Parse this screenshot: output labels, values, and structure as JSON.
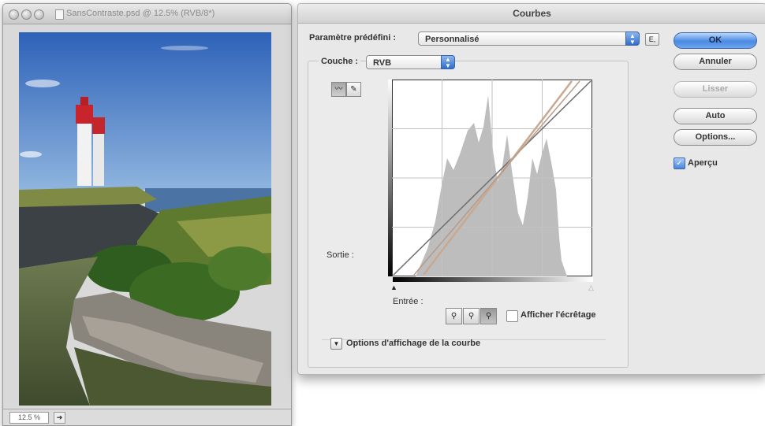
{
  "document": {
    "title": "SansContraste.psd @ 12.5% (RVB/8*)",
    "zoom": "12.5 %",
    "status_icon": "➔"
  },
  "curves_dialog": {
    "title": "Courbes",
    "preset_label": "Paramètre prédéfini :",
    "preset_value": "Personnalisé",
    "preset_menu_icon": "E,",
    "channel_label": "Couche :",
    "channel_value": "RVB",
    "output_label": "Sortie :",
    "input_label": "Entrée :",
    "show_clipping_label": "Afficher l'écrêtage",
    "show_clipping_checked": false,
    "curve_display_options_label": "Options d'affichage de la courbe",
    "buttons": {
      "ok": "OK",
      "cancel": "Annuler",
      "smooth": "Lisser",
      "auto": "Auto",
      "options": "Options..."
    },
    "preview_label": "Aperçu",
    "preview_checked": true,
    "icons": {
      "point_mode": "curve-point-icon",
      "pencil_mode": "pencil-icon",
      "black_eyedropper": "eyedropper-black-icon",
      "gray_eyedropper": "eyedropper-gray-icon",
      "white_eyedropper": "eyedropper-white-icon",
      "disclosure": "triangle-down-icon"
    },
    "curve": {
      "baseline": [
        [
          0,
          0
        ],
        [
          255,
          255
        ]
      ],
      "adjusted_points": [
        [
          18,
          0
        ],
        [
          242,
          255
        ]
      ],
      "adjusted_points_2": [
        [
          10,
          0
        ],
        [
          248,
          255
        ]
      ]
    },
    "histogram_color": "#bdbdbd",
    "curve_color": "#c9a890",
    "accent_color": "#4a8ae3"
  }
}
